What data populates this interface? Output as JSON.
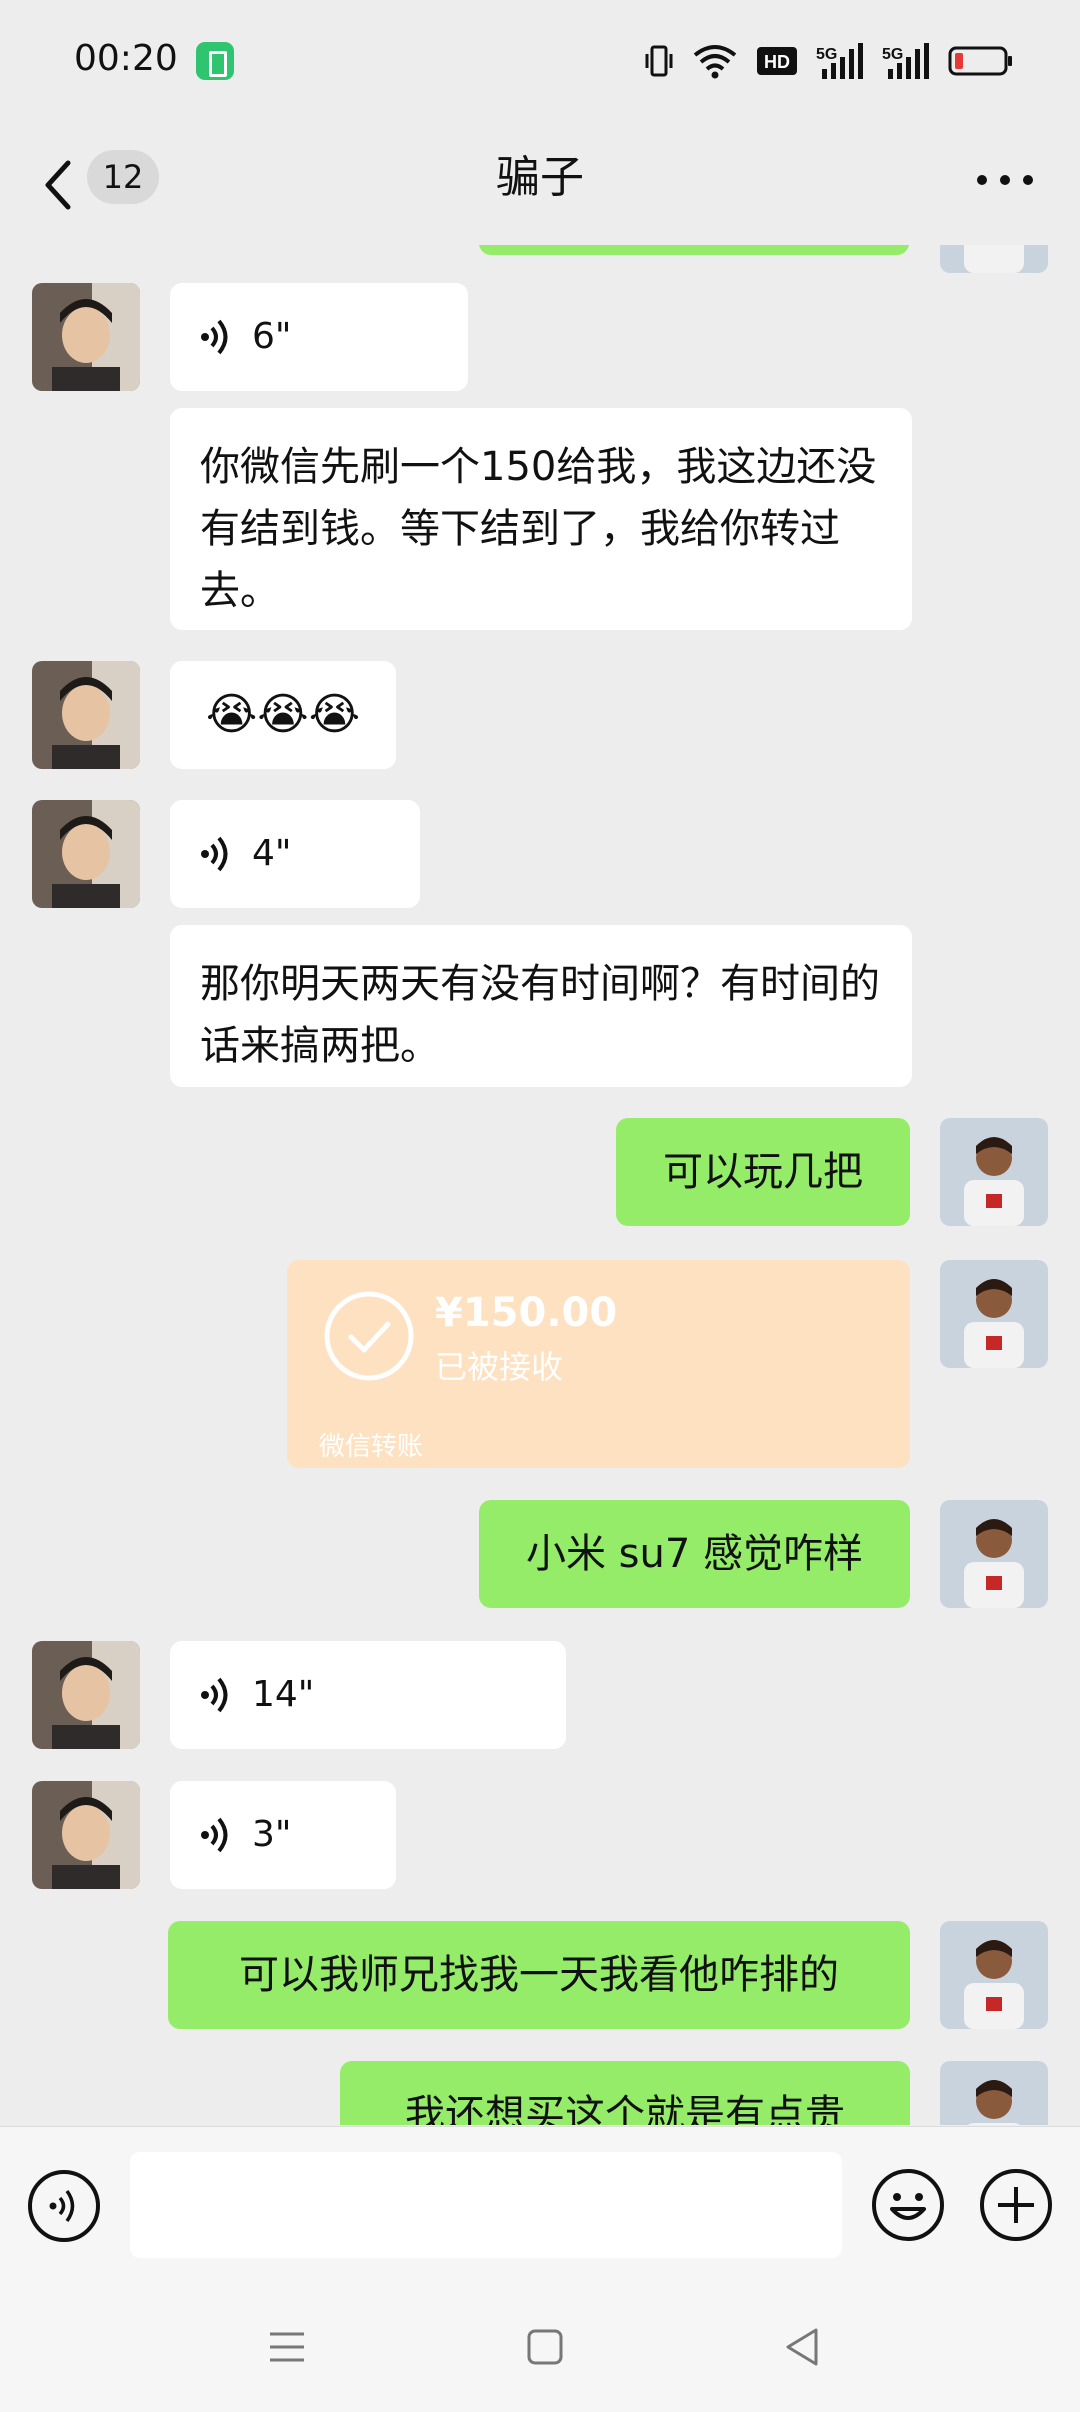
{
  "status_bar": {
    "time": "00:20",
    "icons": [
      "battery-saver-icon",
      "vibrate-icon",
      "wifi-icon",
      "hd-icon",
      "5g-signal-icon",
      "5g-signal-icon",
      "battery-low-icon"
    ],
    "hd_label": "HD",
    "network_label": "5G",
    "battery_color": "#e53935"
  },
  "header": {
    "back_count": "12",
    "title": "骗子"
  },
  "messages": [
    {
      "from": "contact",
      "type": "voice",
      "duration": "6\""
    },
    {
      "from": "contact",
      "type": "text",
      "text": "你微信先刷一个150给我，我这边还没有结到钱。等下结到了，我给你转过去。"
    },
    {
      "from": "contact",
      "type": "emoji",
      "text": "😭😭😭"
    },
    {
      "from": "contact",
      "type": "voice",
      "duration": "4\""
    },
    {
      "from": "contact",
      "type": "text",
      "text": "那你明天两天有没有时间啊？有时间的话来搞两把。"
    },
    {
      "from": "me",
      "type": "text",
      "text": "可以玩几把"
    },
    {
      "from": "me",
      "type": "transfer",
      "amount": "¥150.00",
      "status": "已被接收",
      "footer": "微信转账"
    },
    {
      "from": "me",
      "type": "text",
      "text": "小米 su7 感觉咋样"
    },
    {
      "from": "contact",
      "type": "voice",
      "duration": "14\""
    },
    {
      "from": "contact",
      "type": "voice",
      "duration": "3\""
    },
    {
      "from": "me",
      "type": "text",
      "text": "可以我师兄找我一天我看他咋排的"
    },
    {
      "from": "me",
      "type": "text",
      "text": "我还想买这个就是有点贵"
    }
  ],
  "input_bar": {
    "value": "",
    "placeholder": ""
  },
  "colors": {
    "background": "#ededed",
    "outgoing_bubble": "#95ec69",
    "incoming_bubble": "#ffffff",
    "transfer_card": "#fde1c1"
  }
}
